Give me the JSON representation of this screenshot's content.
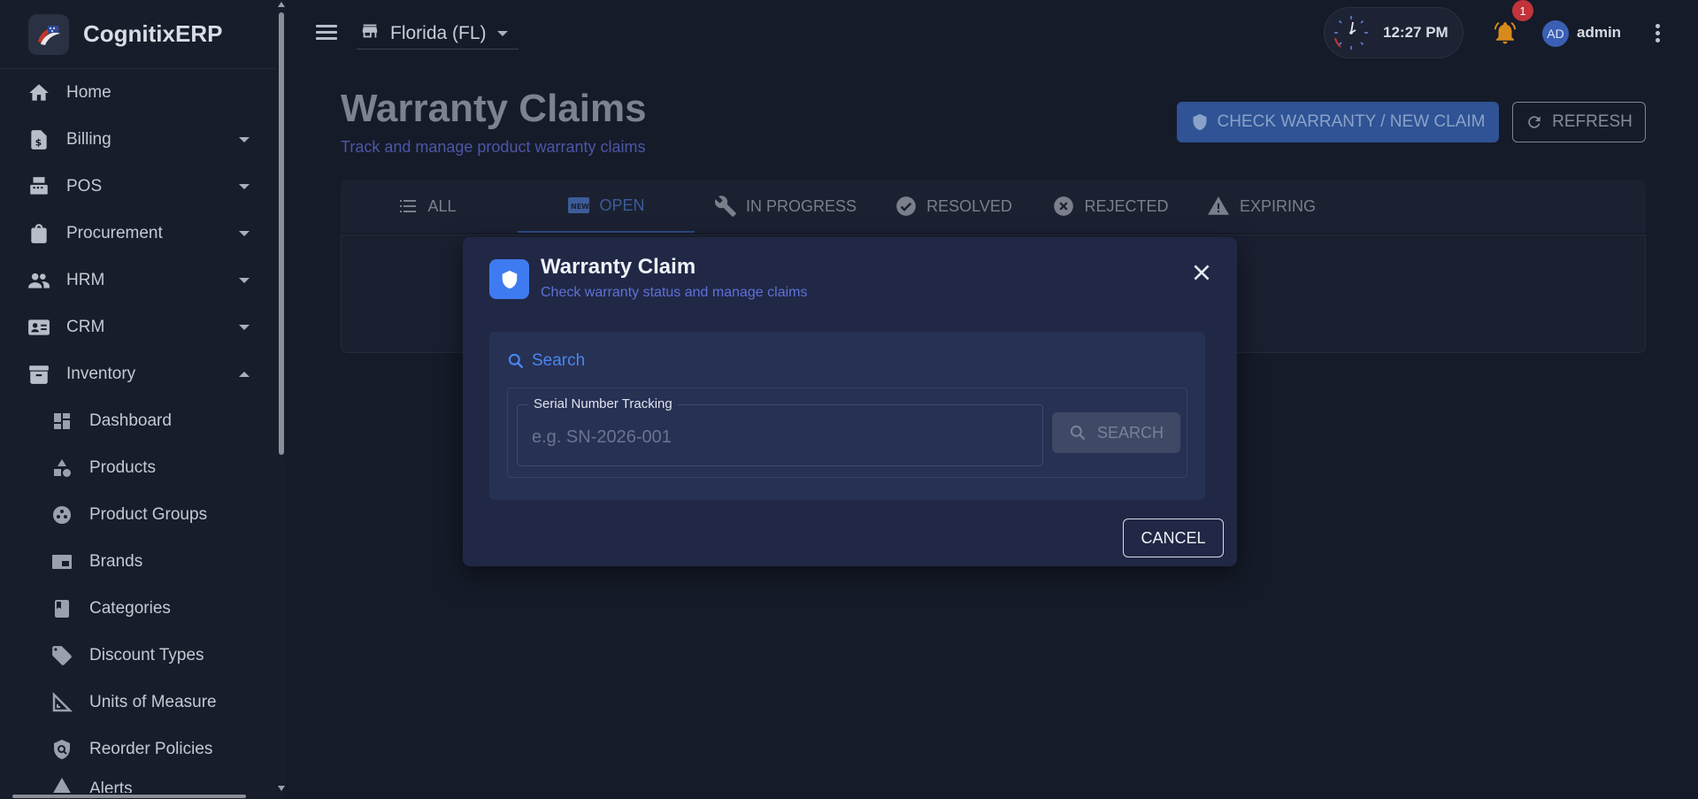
{
  "brand": {
    "name": "CognitixERP"
  },
  "sidebar": {
    "items": [
      {
        "label": "Home",
        "icon": "home-icon"
      },
      {
        "label": "Billing",
        "icon": "billing-icon",
        "expandable": true
      },
      {
        "label": "POS",
        "icon": "pos-icon",
        "expandable": true
      },
      {
        "label": "Procurement",
        "icon": "shopping-bag-icon",
        "expandable": true
      },
      {
        "label": "HRM",
        "icon": "people-icon",
        "expandable": true
      },
      {
        "label": "CRM",
        "icon": "contact-card-icon",
        "expandable": true
      },
      {
        "label": "Inventory",
        "icon": "archive-icon",
        "expanded": true
      }
    ],
    "inventory_sub": [
      {
        "label": "Dashboard",
        "icon": "dashboard-icon"
      },
      {
        "label": "Products",
        "icon": "shapes-icon"
      },
      {
        "label": "Product Groups",
        "icon": "group-icon"
      },
      {
        "label": "Brands",
        "icon": "brand-icon"
      },
      {
        "label": "Categories",
        "icon": "book-icon"
      },
      {
        "label": "Discount Types",
        "icon": "tag-icon"
      },
      {
        "label": "Units of Measure",
        "icon": "ruler-icon"
      },
      {
        "label": "Reorder Policies",
        "icon": "policy-shield-icon"
      },
      {
        "label": "Alerts",
        "icon": "alert-icon"
      }
    ]
  },
  "topbar": {
    "store": "Florida (FL)",
    "time": "12:27 PM",
    "notification_count": "1",
    "avatar_initials": "AD",
    "username": "admin"
  },
  "page": {
    "title": "Warranty Claims",
    "subtitle": "Track and manage product warranty claims",
    "primary_action": "CHECK WARRANTY / NEW CLAIM",
    "refresh_label": "REFRESH",
    "tabs": [
      {
        "label": "ALL",
        "icon": "list-icon"
      },
      {
        "label": "OPEN",
        "icon": "new-badge-icon",
        "active": true
      },
      {
        "label": "IN PROGRESS",
        "icon": "wrench-icon"
      },
      {
        "label": "RESOLVED",
        "icon": "check-circle-icon"
      },
      {
        "label": "REJECTED",
        "icon": "cancel-circle-icon"
      },
      {
        "label": "EXPIRING",
        "icon": "warning-icon"
      }
    ]
  },
  "modal": {
    "title": "Warranty Claim",
    "subtitle": "Check warranty status and manage claims",
    "search_heading": "Search",
    "field_label": "Serial Number Tracking",
    "field_placeholder": "e.g. SN-2026-001",
    "field_value": "",
    "search_button": "SEARCH",
    "cancel_button": "CANCEL"
  },
  "colors": {
    "background": "#151b29",
    "sidebar": "#171d2b",
    "modal": "#202845",
    "accent_blue": "#3f7bf0",
    "subtitle_purple": "#5f70d8",
    "badge_red": "#c2333a",
    "bell_orange": "#d98a1c"
  }
}
